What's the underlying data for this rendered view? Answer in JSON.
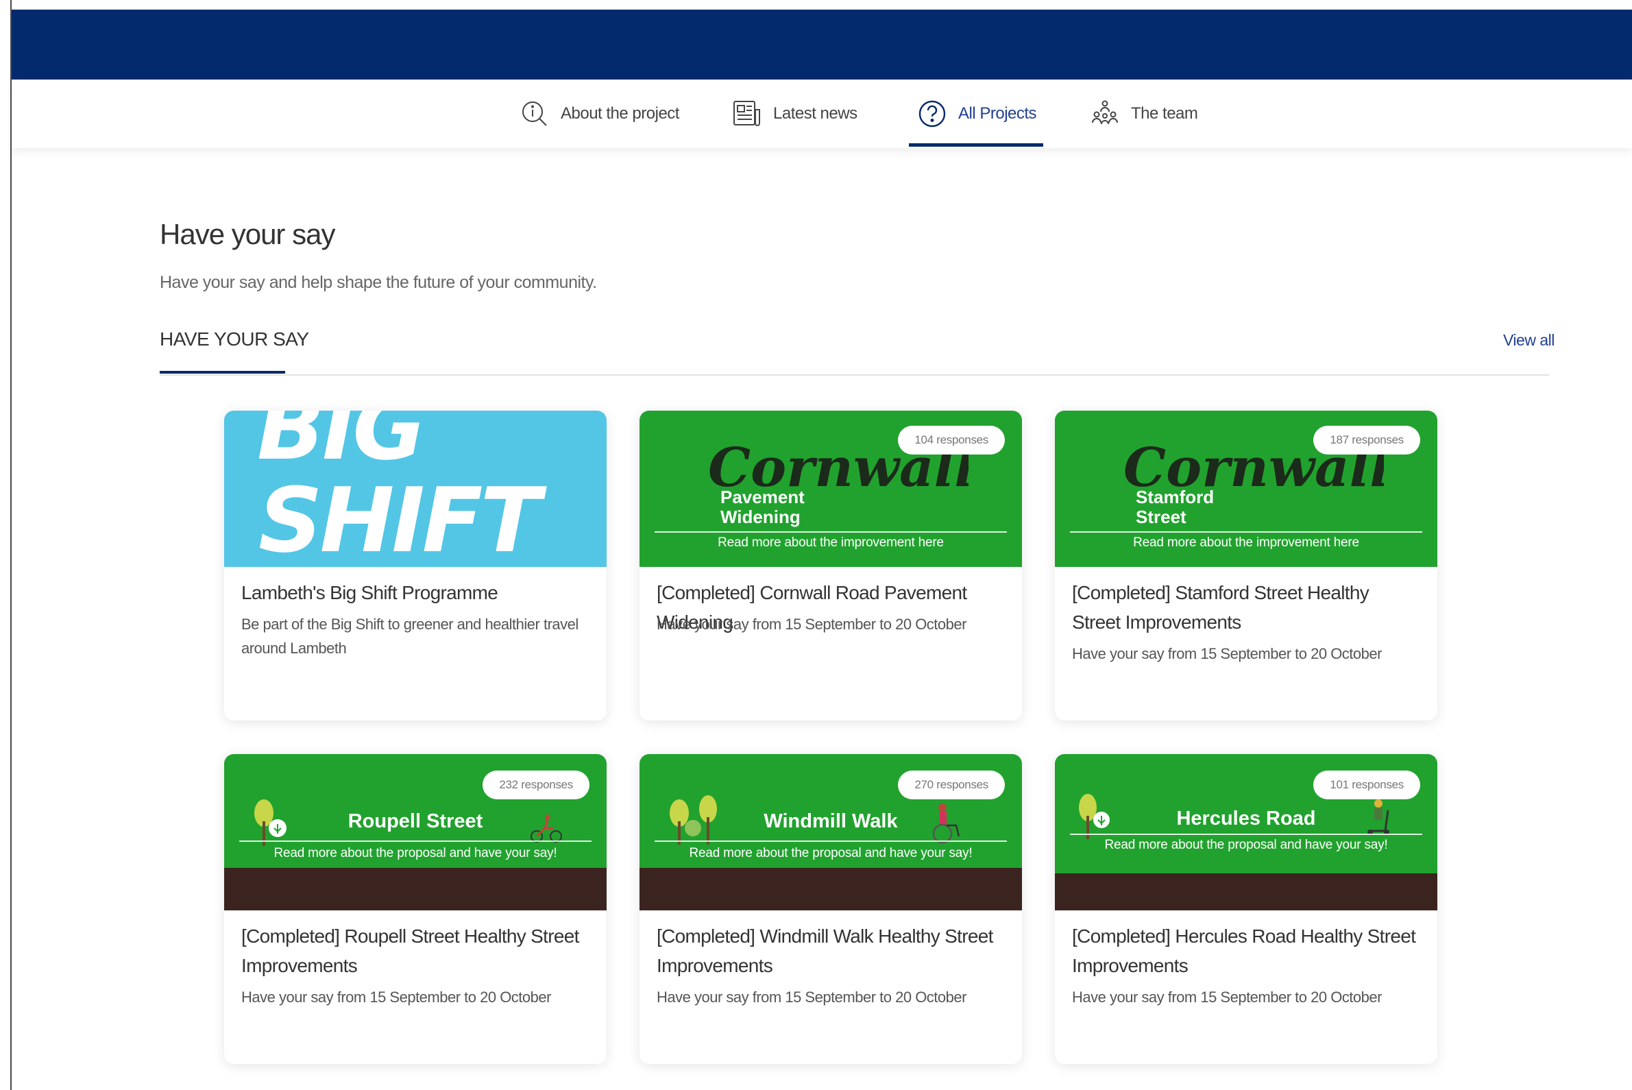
{
  "nav": {
    "items": [
      {
        "label": "About the project",
        "icon": "info-search-icon"
      },
      {
        "label": "Latest news",
        "icon": "newspaper-icon"
      },
      {
        "label": "All Projects",
        "icon": "question-circle-icon",
        "active": true
      },
      {
        "label": "The team",
        "icon": "team-icon"
      }
    ]
  },
  "section": {
    "title": "Have your say",
    "subtitle": "Have your say and help shape the future of your community.",
    "tab_label": "HAVE YOUR SAY",
    "view_all": "View all"
  },
  "colors": {
    "brand_navy": "#022a6c",
    "link_blue": "#1f3f93",
    "banner_green": "#21a22e",
    "bigshift_blue": "#53c6e6",
    "soil_brown": "#3b2420"
  },
  "cards": [
    {
      "title": "Lambeth's Big Shift Programme",
      "description": "Be part of the Big Shift to greener and healthier travel around Lambeth",
      "banner": {
        "word1": "BIG",
        "word2": "SHIFT"
      }
    },
    {
      "title": "[Completed] Cornwall Road Pavement Widening",
      "description": "Have your say from 15 September to 20 October",
      "responses": "104 responses",
      "banner": {
        "script": "Cornwall Road",
        "sub1": "Pavement",
        "sub2": "Widening",
        "read_more": "Read more about the improvement here"
      }
    },
    {
      "title": "[Completed] Stamford Street Healthy Street Improvements",
      "description": "Have your say from 15 September to 20 October",
      "responses": "187 responses",
      "banner": {
        "script": "Cornwall Road",
        "sub1": "Stamford",
        "sub2": "Street",
        "read_more": "Read more about the improvement here"
      }
    },
    {
      "title": "[Completed] Roupell Street Healthy Street Improvements",
      "description": "Have your say from 15 September to 20 October",
      "responses": "232 responses",
      "banner": {
        "street": "Roupell Street",
        "read_more": "Read more about the proposal and have your say!"
      }
    },
    {
      "title": "[Completed] Windmill Walk Healthy Street Improvements",
      "description": "Have your say from 15 September to 20 October",
      "responses": "270 responses",
      "banner": {
        "street": "Windmill Walk",
        "read_more": "Read more about the proposal and have your say!"
      }
    },
    {
      "title": "[Completed] Hercules Road Healthy Street Improvements",
      "description": "Have your say from 15 September to 20 October",
      "responses": "101 responses",
      "banner": {
        "street": "Hercules Road",
        "read_more": "Read more about the proposal and have your say!"
      }
    }
  ]
}
